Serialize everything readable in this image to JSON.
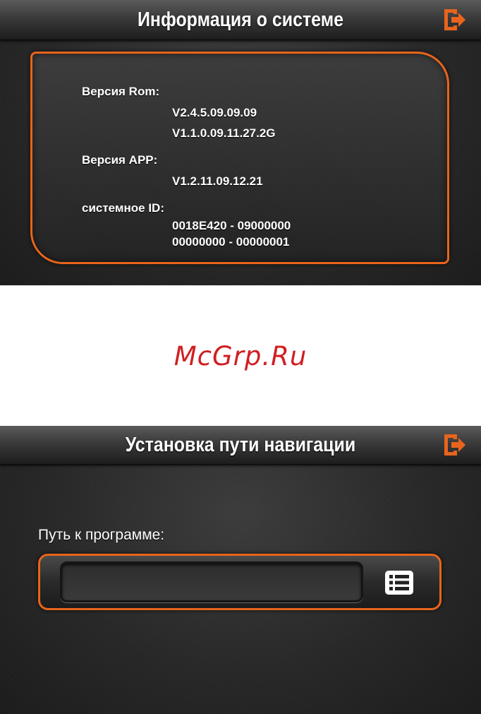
{
  "screen1": {
    "title": "Информация о системе",
    "exit_icon": "exit-arrow-icon",
    "rom_label": "Версия Rom:",
    "rom_values": [
      "V2.4.5.09.09.09",
      "V1.1.0.09.11.27.2G"
    ],
    "app_label": "Версия APP:",
    "app_value": "V1.2.11.09.12.21",
    "id_label": "системное ID:",
    "id_values": [
      "0018E420 - 09000000",
      "00000000 - 00000001"
    ]
  },
  "watermark": "McGrp.Ru",
  "screen2": {
    "title": "Установка пути навигации",
    "exit_icon": "exit-arrow-icon",
    "path_label": "Путь к программе:",
    "path_value": "",
    "browse_icon": "list-icon"
  },
  "colors": {
    "accent": "#e8641c",
    "watermark": "#d01f22",
    "text": "#ffffff"
  }
}
